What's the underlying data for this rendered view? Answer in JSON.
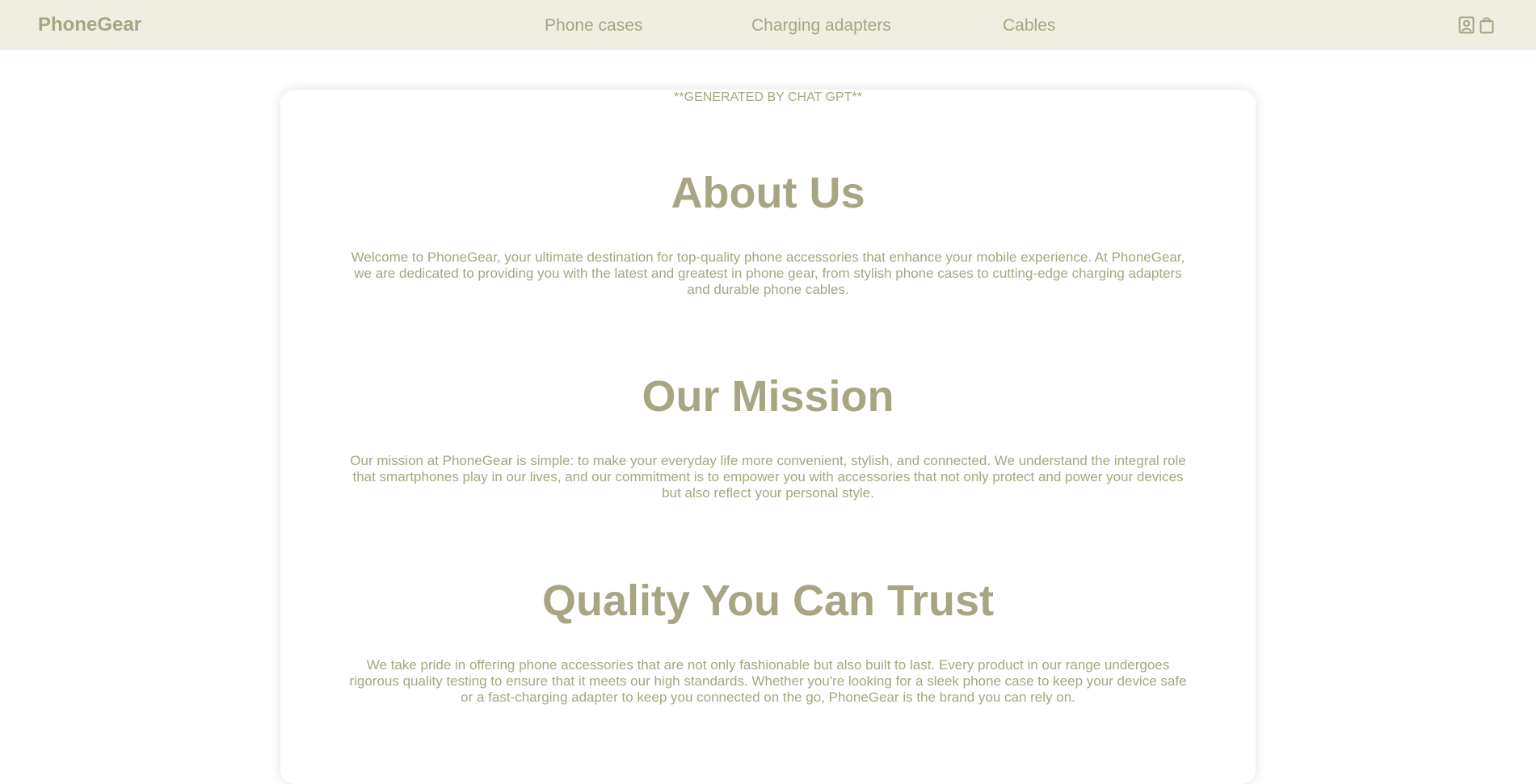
{
  "header": {
    "brand": "PhoneGear",
    "nav": [
      {
        "label": "Phone cases"
      },
      {
        "label": "Charging adapters"
      },
      {
        "label": "Cables"
      }
    ],
    "icons": [
      "account-icon",
      "shopping-bag-icon"
    ]
  },
  "content": {
    "note": "**GENERATED BY CHAT GPT**",
    "sections": [
      {
        "heading": "About Us",
        "body": "Welcome to PhoneGear, your ultimate destination for top-quality phone accessories that enhance your mobile experience. At PhoneGear, we are dedicated to providing you with the latest and greatest in phone gear, from stylish phone cases to cutting-edge charging adapters and durable phone cables."
      },
      {
        "heading": "Our Mission",
        "body": "Our mission at PhoneGear is simple: to make your everyday life more convenient, stylish, and connected. We understand the integral role that smartphones play in our lives, and our commitment is to empower you with accessories that not only protect and power your devices but also reflect your personal style."
      },
      {
        "heading": "Quality You Can Trust",
        "body": "We take pride in offering phone accessories that are not only fashionable but also built to last. Every product in our range undergoes rigorous quality testing to ensure that it meets our high standards. Whether you're looking for a sleek phone case to keep your device safe or a fast-charging adapter to keep you connected on the go, PhoneGear is the brand you can rely on."
      }
    ]
  },
  "colors": {
    "header_bg": "#f0eee1",
    "text": "#a7a583",
    "page_bg": "#ffffff"
  }
}
